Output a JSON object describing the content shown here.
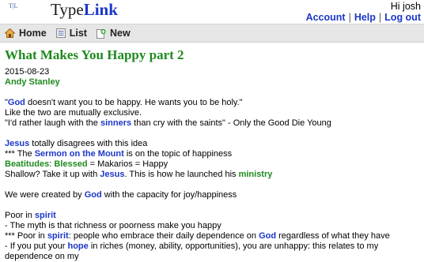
{
  "app": {
    "logo_mark": "T|L",
    "logo_prefix": "Type",
    "logo_suffix": "Link"
  },
  "user": {
    "greeting": "Hi josh",
    "links": [
      "Account",
      "Help",
      "Log out"
    ],
    "separator": "|"
  },
  "nav": {
    "home": "Home",
    "list": "List",
    "new": "New"
  },
  "post": {
    "title": "What Makes You Happy part 2",
    "date": "2015-08-23",
    "author": "Andy Stanley",
    "lines": [
      [
        "\"",
        "God",
        " doesn't want you to be happy. He wants you to be holy.\""
      ],
      [
        "Like the two are mutually exclusive."
      ],
      [
        "\"I'd rather laugh with the ",
        "sinners",
        " than cry with the saints\" - Only the Good Die Young"
      ],
      [
        "Jesus",
        " totally disagrees with this idea"
      ],
      [
        "*** The ",
        "Sermon on the Mount",
        " is on the topic of happiness"
      ],
      [
        "Beatitudes",
        ": ",
        "Blessed",
        " = Makarios = Happy"
      ],
      [
        "Shallow? Take it up with ",
        "Jesus",
        ". This is how he launched his ",
        "ministry"
      ],
      [
        "We were created by ",
        "God",
        " with the capacity for joy/happiness"
      ],
      [
        "Poor in ",
        "spirit"
      ],
      [
        "- The myth is that richness or poorness make you happy"
      ],
      [
        "*** Poor in ",
        "spirit",
        ": people who embrace their daily dependence on ",
        "God",
        " regardless of what they have"
      ],
      [
        "- If you put your ",
        "hope",
        " in riches (money, ability, opportunities), you are unhappy: this relates to my dependence on my"
      ]
    ]
  },
  "colors": {
    "keyword_blue": "#1b37c8",
    "keyword_green": "#1f8a1f",
    "navbar_bg": "#e6e6e6"
  }
}
